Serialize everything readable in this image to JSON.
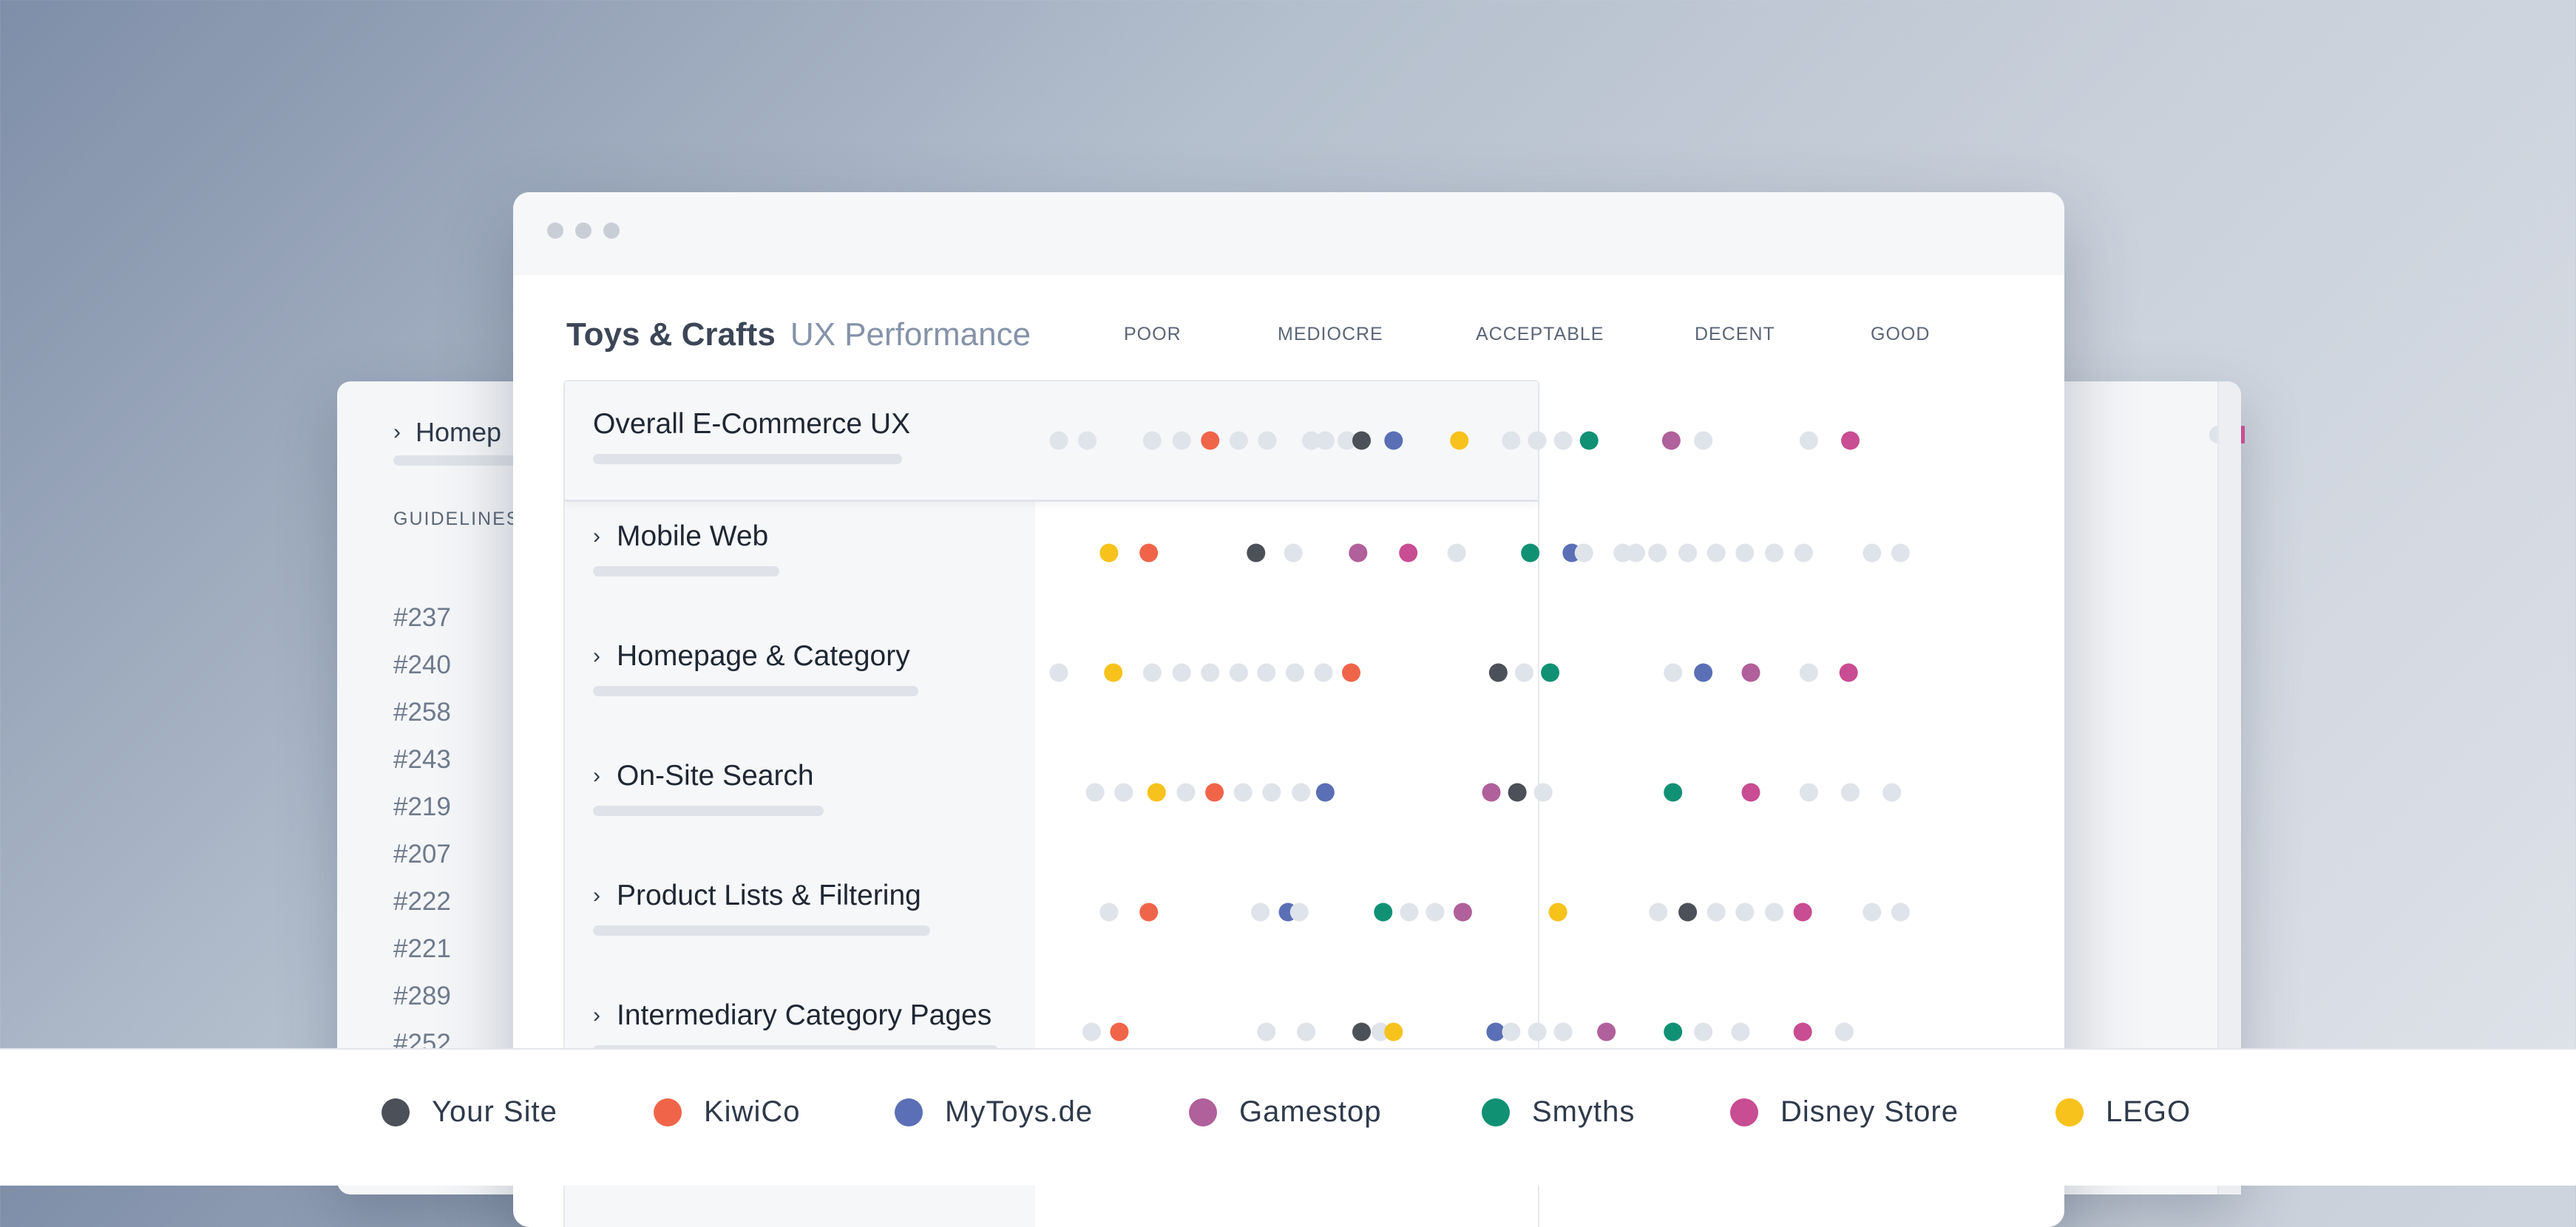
{
  "colors": {
    "your_site": "#4c5058",
    "kiwico": "#f0654a",
    "mytoys": "#5a6fb5",
    "gamestop": "#b0609a",
    "smyths": "#119174",
    "disney": "#c84d92",
    "lego": "#f7c21c",
    "gray": "#dfe3ea"
  },
  "back_window": {
    "breadcrumb": "Homep",
    "section_label": "GUIDELINES",
    "guideline_ids": [
      "#237",
      "#240",
      "#258",
      "#243",
      "#219",
      "#207",
      "#222",
      "#221",
      "#289",
      "#252"
    ]
  },
  "main_window": {
    "title_main": "Toys & Crafts",
    "title_sub": "UX Performance",
    "scale": [
      "POOR",
      "MEDIOCRE",
      "ACCEPTABLE",
      "DECENT",
      "GOOD"
    ],
    "rows": [
      {
        "label": "Overall E-Commerce UX",
        "chevron": "",
        "dots": [
          [
            0.0,
            "gray"
          ],
          [
            0.033,
            "gray"
          ],
          [
            0.108,
            "gray"
          ],
          [
            0.142,
            "gray"
          ],
          [
            0.175,
            "kiwico"
          ],
          [
            0.208,
            "gray"
          ],
          [
            0.241,
            "gray"
          ],
          [
            0.292,
            "gray"
          ],
          [
            0.308,
            "gray"
          ],
          [
            0.333,
            "gray"
          ],
          [
            0.35,
            "your_site"
          ],
          [
            0.387,
            "mytoys"
          ],
          [
            0.463,
            "lego"
          ],
          [
            0.523,
            "gray"
          ],
          [
            0.553,
            "gray"
          ],
          [
            0.583,
            "gray"
          ],
          [
            0.613,
            "smyths"
          ],
          [
            0.708,
            "gamestop"
          ],
          [
            0.745,
            "gray"
          ],
          [
            0.867,
            "gray"
          ],
          [
            0.915,
            "disney"
          ]
        ]
      },
      {
        "label": "Mobile Web",
        "chevron": "›",
        "dots": [
          [
            0.058,
            "lego"
          ],
          [
            0.104,
            "kiwico"
          ],
          [
            0.228,
            "your_site"
          ],
          [
            0.271,
            "gray"
          ],
          [
            0.346,
            "gamestop"
          ],
          [
            0.404,
            "disney"
          ],
          [
            0.46,
            "gray"
          ],
          [
            0.545,
            "smyths"
          ],
          [
            0.593,
            "mytoys"
          ],
          [
            0.607,
            "gray"
          ],
          [
            0.652,
            "gray"
          ],
          [
            0.667,
            "gray"
          ],
          [
            0.692,
            "gray"
          ],
          [
            0.727,
            "gray"
          ],
          [
            0.76,
            "gray"
          ],
          [
            0.793,
            "gray"
          ],
          [
            0.827,
            "gray"
          ],
          [
            0.861,
            "gray"
          ],
          [
            0.94,
            "gray"
          ],
          [
            0.973,
            "gray"
          ]
        ]
      },
      {
        "label": "Homepage & Category",
        "chevron": "›",
        "dots": [
          [
            0.0,
            "gray"
          ],
          [
            0.063,
            "lego"
          ],
          [
            0.108,
            "gray"
          ],
          [
            0.142,
            "gray"
          ],
          [
            0.175,
            "gray"
          ],
          [
            0.208,
            "gray"
          ],
          [
            0.24,
            "gray"
          ],
          [
            0.273,
            "gray"
          ],
          [
            0.306,
            "gray"
          ],
          [
            0.338,
            "kiwico"
          ],
          [
            0.508,
            "your_site"
          ],
          [
            0.538,
            "gray"
          ],
          [
            0.568,
            "smyths"
          ],
          [
            0.71,
            "gray"
          ],
          [
            0.745,
            "mytoys"
          ],
          [
            0.8,
            "gamestop"
          ],
          [
            0.867,
            "gray"
          ],
          [
            0.913,
            "disney"
          ]
        ]
      },
      {
        "label": "On-Site Search",
        "chevron": "›",
        "dots": [
          [
            0.042,
            "gray"
          ],
          [
            0.075,
            "gray"
          ],
          [
            0.113,
            "lego"
          ],
          [
            0.147,
            "gray"
          ],
          [
            0.18,
            "kiwico"
          ],
          [
            0.213,
            "gray"
          ],
          [
            0.246,
            "gray"
          ],
          [
            0.28,
            "gray"
          ],
          [
            0.308,
            "mytoys"
          ],
          [
            0.5,
            "gamestop"
          ],
          [
            0.53,
            "your_site"
          ],
          [
            0.56,
            "gray"
          ],
          [
            0.71,
            "smyths"
          ],
          [
            0.8,
            "disney"
          ],
          [
            0.867,
            "gray"
          ],
          [
            0.915,
            "gray"
          ],
          [
            0.963,
            "gray"
          ]
        ]
      },
      {
        "label": "Product Lists & Filtering",
        "chevron": "›",
        "dots": [
          [
            0.058,
            "gray"
          ],
          [
            0.104,
            "kiwico"
          ],
          [
            0.233,
            "gray"
          ],
          [
            0.265,
            "mytoys"
          ],
          [
            0.278,
            "gray"
          ],
          [
            0.375,
            "smyths"
          ],
          [
            0.405,
            "gray"
          ],
          [
            0.435,
            "gray"
          ],
          [
            0.467,
            "gamestop"
          ],
          [
            0.577,
            "lego"
          ],
          [
            0.693,
            "gray"
          ],
          [
            0.727,
            "your_site"
          ],
          [
            0.76,
            "gray"
          ],
          [
            0.793,
            "gray"
          ],
          [
            0.827,
            "gray"
          ],
          [
            0.86,
            "disney"
          ],
          [
            0.94,
            "gray"
          ],
          [
            0.973,
            "gray"
          ]
        ]
      },
      {
        "label": "Intermediary Category Pages",
        "chevron": "›",
        "dots": [
          [
            0.038,
            "gray"
          ],
          [
            0.07,
            "kiwico"
          ],
          [
            0.24,
            "gray"
          ],
          [
            0.286,
            "gray"
          ],
          [
            0.35,
            "your_site"
          ],
          [
            0.372,
            "gray"
          ],
          [
            0.387,
            "lego"
          ],
          [
            0.505,
            "mytoys"
          ],
          [
            0.523,
            "gray"
          ],
          [
            0.553,
            "gray"
          ],
          [
            0.583,
            "gray"
          ],
          [
            0.633,
            "gamestop"
          ],
          [
            0.71,
            "smyths"
          ],
          [
            0.745,
            "gray"
          ],
          [
            0.788,
            "gray"
          ],
          [
            0.86,
            "disney"
          ],
          [
            0.908,
            "gray"
          ]
        ]
      }
    ]
  },
  "legend": [
    {
      "label": "Your Site",
      "color": "#4c5058"
    },
    {
      "label": "KiwiCo",
      "color": "#f0654a"
    },
    {
      "label": "MyToys.de",
      "color": "#5a6fb5"
    },
    {
      "label": "Gamestop",
      "color": "#b0609a"
    },
    {
      "label": "Smyths",
      "color": "#119174"
    },
    {
      "label": "Disney Store",
      "color": "#c84d92"
    },
    {
      "label": "LEGO",
      "color": "#f7c21c"
    }
  ]
}
